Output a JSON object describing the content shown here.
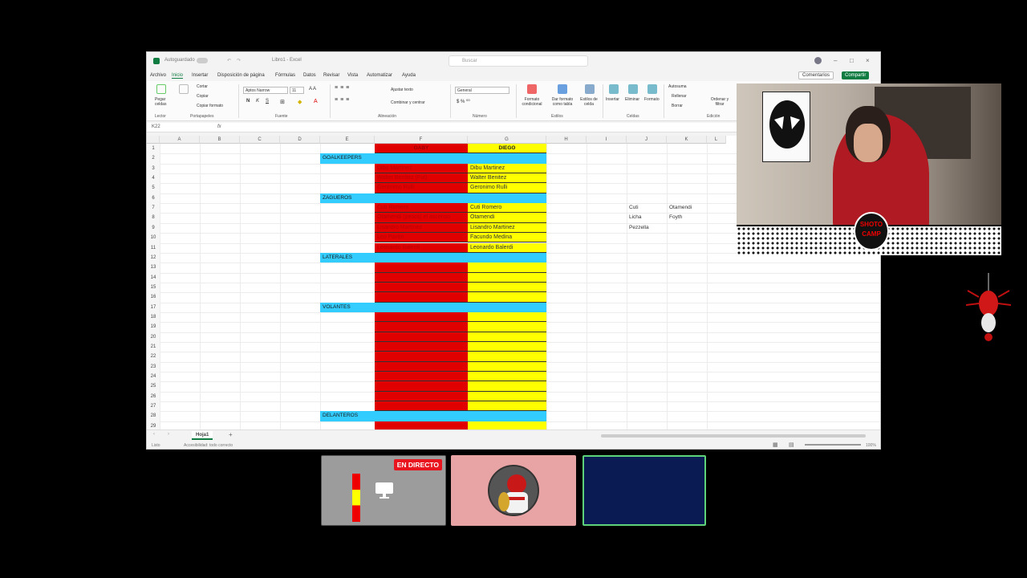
{
  "excel": {
    "titlebar": {
      "autosave": "Autoguardado",
      "filename": "Libro1 - Excel",
      "search_placeholder": "Buscar"
    },
    "menu": [
      "Archivo",
      "Inicio",
      "Insertar",
      "Disposición de página",
      "Fórmulas",
      "Datos",
      "Revisar",
      "Vista",
      "Automatizar",
      "Ayuda"
    ],
    "comments_label": "Comentarios",
    "share_label": "Compartir",
    "ribbon": {
      "paste": "Pegar celdas",
      "cut": "Cortar",
      "copy": "Copiar",
      "format_painter": "Copiar formato",
      "font_name": "Aptos Narrow",
      "font_size": "11",
      "wrap_text": "Ajustar texto",
      "merge_center": "Combinar y centrar",
      "number_format": "General",
      "conditional_format": "Formato condicional",
      "format_table": "Dar formato como tabla",
      "cell_styles": "Estilos de celda",
      "insert": "Insertar",
      "delete": "Eliminar",
      "format": "Formato",
      "autosum": "Autosuma",
      "fill": "Rellenar",
      "clear": "Borrar",
      "sort_filter": "Ordenar y filtrar",
      "groups": [
        "Lector",
        "Portapapeles",
        "Fuente",
        "Alineación",
        "Número",
        "Estilos",
        "Celdas",
        "Edición"
      ]
    },
    "name_box": "K22",
    "fx": "fx",
    "columns": [
      "A",
      "B",
      "C",
      "D",
      "E",
      "F",
      "G",
      "H",
      "I",
      "J",
      "K",
      "L"
    ],
    "rows": [
      "1",
      "2",
      "3",
      "4",
      "5",
      "6",
      "7",
      "8",
      "9",
      "10",
      "11",
      "12",
      "13",
      "14",
      "15",
      "16",
      "17",
      "18",
      "19",
      "20",
      "21",
      "22",
      "23",
      "24",
      "25",
      "26",
      "27",
      "28",
      "29"
    ],
    "headers": {
      "f1": "GABY",
      "g1": "DIEGO"
    },
    "sections": {
      "goalkeepers": "GOALKEEPERS",
      "zagueros": "ZAGUEROS",
      "laterales": "LATERALES",
      "volantes": "VOLANTES",
      "delanteros": "DELANTEROS"
    },
    "gaby_players": [
      "Dibu Martínez",
      "Walter Benítez (Fut)",
      "Gerónimo Rulli",
      "Cuti Romero",
      "Otamendi (pesos) el ascenso",
      "Lisandro Martínez",
      "Leo Pavón",
      "Leonardo Balerdi"
    ],
    "diego_players": [
      "Dibu Martinez",
      "Walter Benitez",
      "Geronimo Rulli",
      "Cuti Romero",
      "Otamendi",
      "Lisandro Martinez",
      "Facundo Medina",
      "Leonardo Balerdi"
    ],
    "side_notes": {
      "j7": "Cuti",
      "k7": "Otamendi",
      "j8": "Licha",
      "k8": "Foyth",
      "j9": "Pezzella"
    },
    "sheet_tab": "Hoja1",
    "status_ready": "Listo",
    "status_accessibility": "Accesibilidad: todo correcto",
    "zoom": "100%"
  },
  "stream": {
    "live_badge": "EN DIRECTO",
    "webcam_logo": "SHOTO CAMP"
  },
  "colors": {
    "red": "#e00000",
    "yellow": "#ffff00",
    "cyan": "#33ccff",
    "excel_green": "#107c41"
  }
}
